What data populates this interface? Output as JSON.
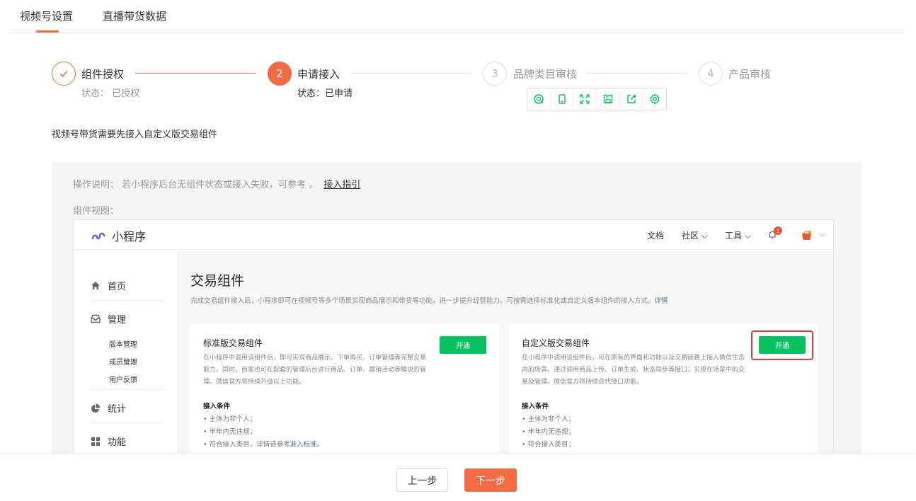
{
  "tabs": [
    {
      "label": "视频号设置"
    },
    {
      "label": "直播带货数据"
    }
  ],
  "steps": [
    {
      "number": "",
      "title": "组件授权",
      "status": "状态： 已授权"
    },
    {
      "number": "2",
      "title": "申请接入",
      "status": "状态：已申请"
    },
    {
      "number": "3",
      "title": "品牌类目审核",
      "status": ""
    },
    {
      "number": "4",
      "title": "产品审核",
      "status": ""
    }
  ],
  "toolbar": {
    "icons": [
      "search-icon",
      "phone-icon",
      "fullscreen-icon",
      "save-icon",
      "share-icon",
      "settings-icon"
    ]
  },
  "description": "视频号带货需要先接入自定义版交易组件",
  "panel": {
    "op_label": "操作说明：  若小程序后台无组件状态或接入失败，可参考 。",
    "op_link": "接入指引",
    "view_label": "组件视图："
  },
  "preview": {
    "logo_text": "小程序",
    "nav": [
      "文档",
      "社区",
      "工具"
    ],
    "notification_count": "1",
    "sidebar": {
      "home": "首页",
      "manage": "管理",
      "sub_items": [
        "版本管理",
        "成员管理",
        "用户反馈"
      ],
      "stats": "统计",
      "features": "功能"
    },
    "title": "交易组件",
    "intro": "完成交易组件接入后，小程序即可在视频号等多个场景实现商品展示和带货等功能，进一步提升经营能力。可按需选择标准化或自定义版本组件的接入方式。",
    "intro_link": "详情",
    "cards": [
      {
        "title": "标准版交易组件",
        "desc": "在小程序中调用该组件后，即可实现商品展示、下单购买、订单管理等完整交易能力。同时，商家也可在配套的管理后台进行商品、订单、营销活动等模块的管理。微信官方将持续升级以上功能。",
        "button": "开通",
        "cond_title": "接入条件",
        "conds": [
          "主体为非个人；",
          "半年内无违规；",
          "符合接入类目，详情请参考"
        ],
        "cond_link": "准入标准。"
      },
      {
        "title": "自定义版交易组件",
        "desc": "在小程序中调用该组件后，可在原有的界面和功能以及交易链路上接入微信生态内的场景。通过调用商品上传、订单生成、状态同步等接口，实现在场景中的交易及管理。微信官方将持续迭代接口功能。",
        "button": "开通",
        "cond_title": "接入条件",
        "conds": [
          "主体为非个人；",
          "半年内无违规；",
          "符合接入类目；"
        ]
      }
    ]
  },
  "footer": {
    "prev": "上一步",
    "next": "下一步"
  },
  "colors": {
    "accent": "#f26b43",
    "wechat_green": "#07c160",
    "highlight_red": "#e53935"
  }
}
